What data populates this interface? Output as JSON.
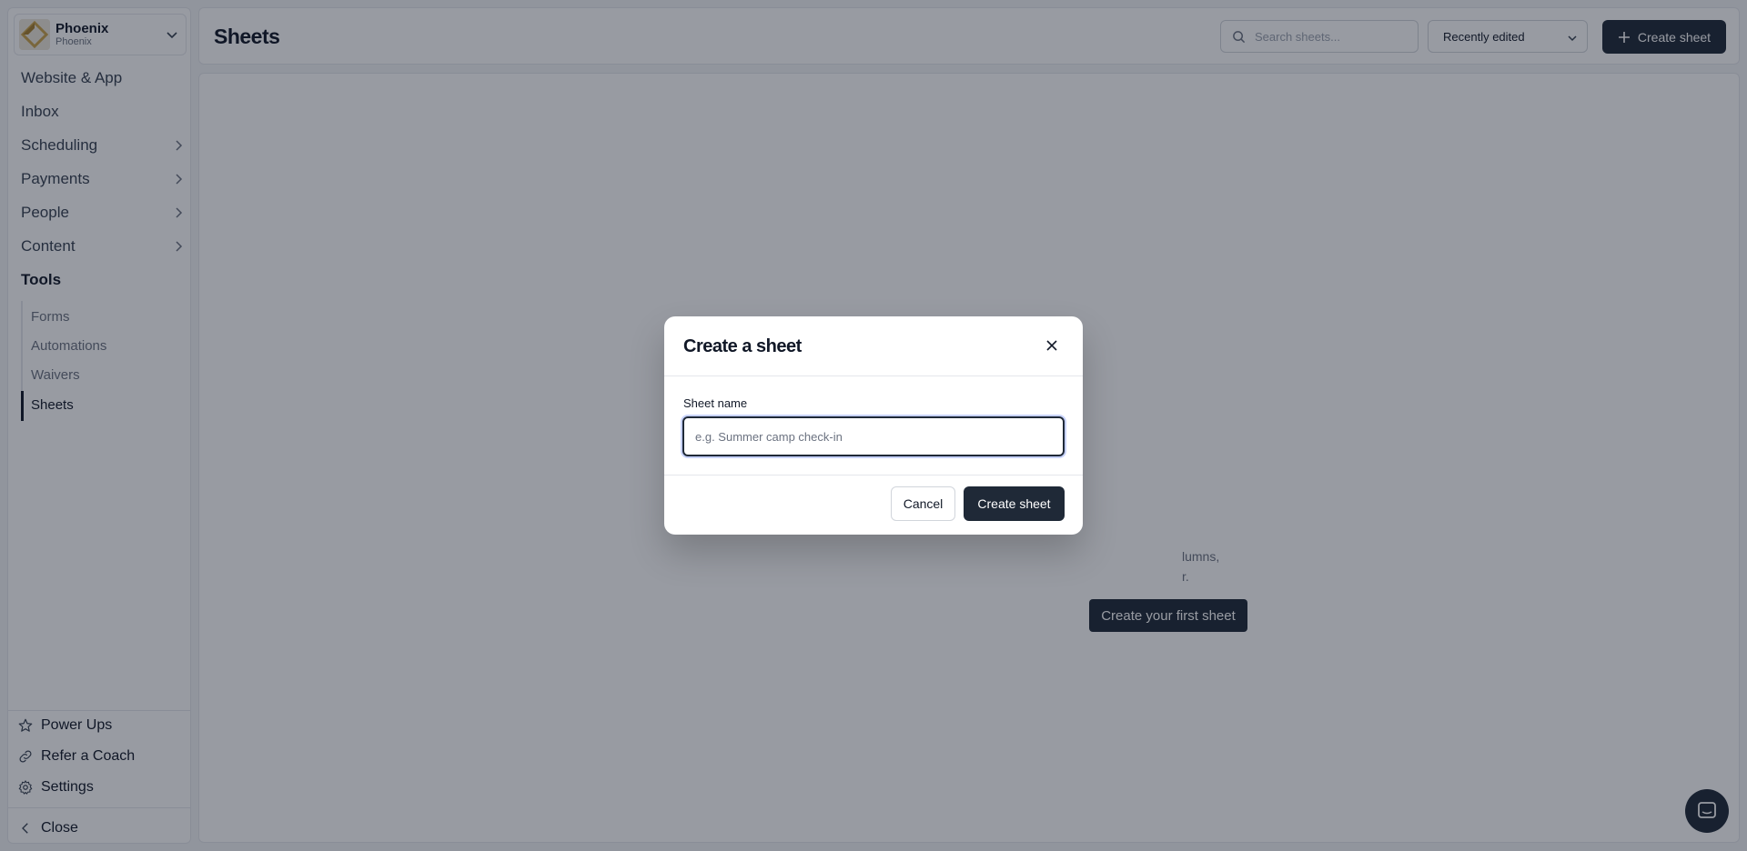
{
  "org": {
    "name": "Phoenix",
    "subtitle": "Phoenix"
  },
  "nav": {
    "website": "Website & App",
    "inbox": "Inbox",
    "scheduling": "Scheduling",
    "payments": "Payments",
    "people": "People",
    "content": "Content",
    "tools": "Tools",
    "tools_sub": [
      "Forms",
      "Automations",
      "Waivers",
      "Sheets"
    ]
  },
  "bottom": {
    "power_ups": "Power Ups",
    "refer": "Refer a Coach",
    "settings": "Settings",
    "close": "Close"
  },
  "header": {
    "title": "Sheets",
    "search_placeholder": "Search sheets...",
    "sort_value": "Recently edited",
    "create_label": "Create sheet"
  },
  "empty": {
    "desc_line1": "lumns,",
    "desc_line2": "r.",
    "cta": "Create your first sheet"
  },
  "modal": {
    "title": "Create a sheet",
    "field_label": "Sheet name",
    "field_placeholder": "e.g. Summer camp check-in",
    "cancel": "Cancel",
    "submit": "Create sheet"
  },
  "colors": {
    "accent": "#1f2937",
    "overlay": "#111827"
  }
}
